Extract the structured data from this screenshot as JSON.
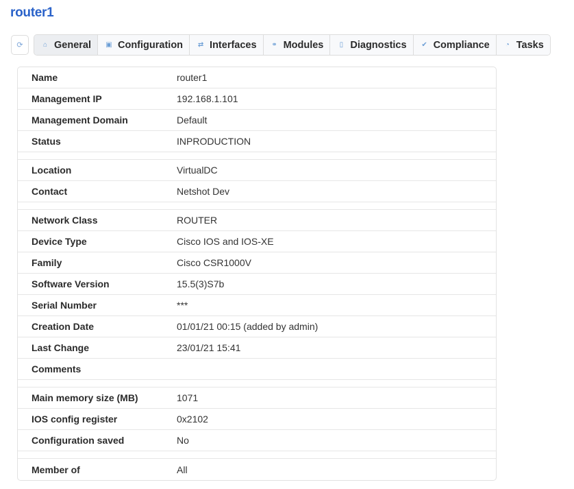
{
  "page": {
    "title": "router1"
  },
  "toolbar": {
    "refresh_icon": "refresh-icon"
  },
  "tabs": [
    {
      "label": "General",
      "icon": "home-icon",
      "glyph": "⌂",
      "active": true
    },
    {
      "label": "Configuration",
      "icon": "config-icon",
      "glyph": "▣",
      "active": false
    },
    {
      "label": "Interfaces",
      "icon": "exchange-icon",
      "glyph": "⇄",
      "active": false
    },
    {
      "label": "Modules",
      "icon": "link-icon",
      "glyph": "⚭",
      "active": false
    },
    {
      "label": "Diagnostics",
      "icon": "clipboard-icon",
      "glyph": "▯",
      "active": false
    },
    {
      "label": "Compliance",
      "icon": "check-icon",
      "glyph": "✔",
      "active": false
    },
    {
      "label": "Tasks",
      "icon": "clock-icon",
      "glyph": "◔",
      "active": false
    }
  ],
  "groups": [
    [
      {
        "label": "Name",
        "value": "router1"
      },
      {
        "label": "Management IP",
        "value": "192.168.1.101"
      },
      {
        "label": "Management Domain",
        "value": "Default"
      },
      {
        "label": "Status",
        "value": "INPRODUCTION"
      }
    ],
    [
      {
        "label": "Location",
        "value": "VirtualDC"
      },
      {
        "label": "Contact",
        "value": "Netshot Dev"
      }
    ],
    [
      {
        "label": "Network Class",
        "value": "ROUTER"
      },
      {
        "label": "Device Type",
        "value": "Cisco IOS and IOS-XE"
      },
      {
        "label": "Family",
        "value": "Cisco CSR1000V"
      },
      {
        "label": "Software Version",
        "value": "15.5(3)S7b"
      },
      {
        "label": "Serial Number",
        "value": "***"
      },
      {
        "label": "Creation Date",
        "value": "01/01/21 00:15 (added by admin)"
      },
      {
        "label": "Last Change",
        "value": "23/01/21 15:41"
      },
      {
        "label": "Comments",
        "value": ""
      }
    ],
    [
      {
        "label": "Main memory size (MB)",
        "value": "1071"
      },
      {
        "label": "IOS config register",
        "value": "0x2102"
      },
      {
        "label": "Configuration saved",
        "value": "No"
      }
    ],
    [
      {
        "label": "Member of",
        "value": "All"
      }
    ]
  ]
}
